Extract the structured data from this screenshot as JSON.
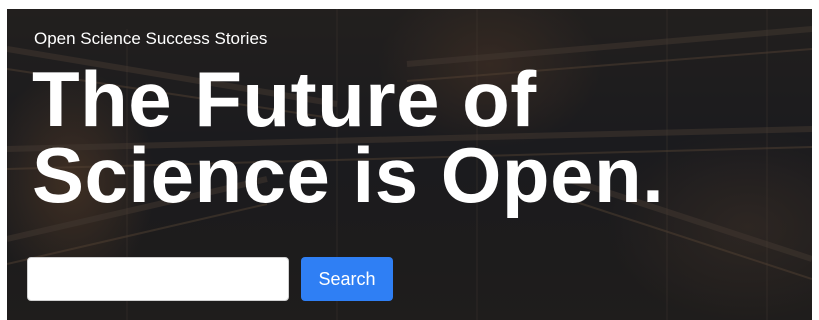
{
  "hero": {
    "tagline": "Open Science Success Stories",
    "headline_line1": "The Future of",
    "headline_line2": "Science is Open."
  },
  "search": {
    "input_value": "",
    "placeholder": "",
    "button_label": "Search"
  },
  "colors": {
    "button_bg": "#2f7ff4",
    "text": "#ffffff",
    "overlay": "#1f1f22"
  }
}
